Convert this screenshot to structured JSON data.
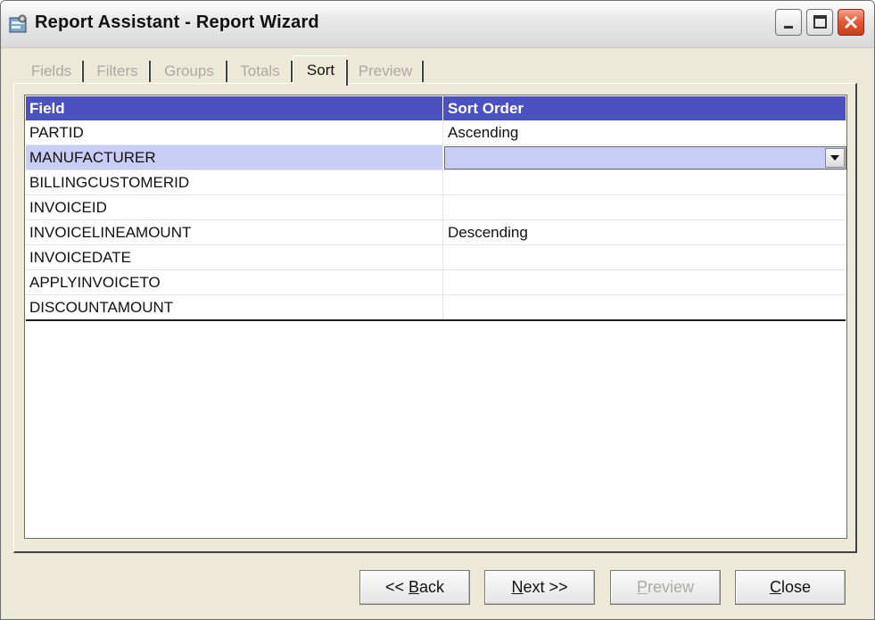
{
  "window": {
    "title": "Report Assistant - Report Wizard"
  },
  "tabs": [
    {
      "label": "Fields",
      "enabled": false
    },
    {
      "label": "Filters",
      "enabled": false
    },
    {
      "label": "Groups",
      "enabled": false
    },
    {
      "label": "Totals",
      "enabled": false
    },
    {
      "label": "Sort",
      "enabled": true,
      "active": true
    },
    {
      "label": "Preview",
      "enabled": false
    }
  ],
  "table": {
    "headers": {
      "field": "Field",
      "sort_order": "Sort Order"
    },
    "rows": [
      {
        "field": "PARTID",
        "sort_order": "Ascending"
      },
      {
        "field": "MANUFACTURER",
        "sort_order": ""
      },
      {
        "field": "BILLINGCUSTOMERID",
        "sort_order": ""
      },
      {
        "field": "INVOICEID",
        "sort_order": ""
      },
      {
        "field": "INVOICELINEAMOUNT",
        "sort_order": "Descending"
      },
      {
        "field": "INVOICEDATE",
        "sort_order": ""
      },
      {
        "field": "APPLYINVOICETO",
        "sort_order": ""
      },
      {
        "field": "DISCOUNTAMOUNT",
        "sort_order": ""
      }
    ],
    "selected_row": "MANUFACTURER"
  },
  "buttons": {
    "back": {
      "pre": "<< ",
      "mnemonic": "B",
      "post": "ack"
    },
    "next": {
      "pre": "",
      "mnemonic": "N",
      "post": "ext >>"
    },
    "preview": {
      "pre": "",
      "mnemonic": "P",
      "post": "review"
    },
    "close": {
      "pre": "",
      "mnemonic": "C",
      "post": "lose"
    }
  },
  "colors": {
    "header_bg": "#4b51c0",
    "selection_bg": "#c9cdf6",
    "dialog_bg": "#ece9d8"
  },
  "icons": [
    "app-icon",
    "minimize-icon",
    "maximize-icon",
    "close-icon",
    "dropdown-arrow-icon"
  ]
}
